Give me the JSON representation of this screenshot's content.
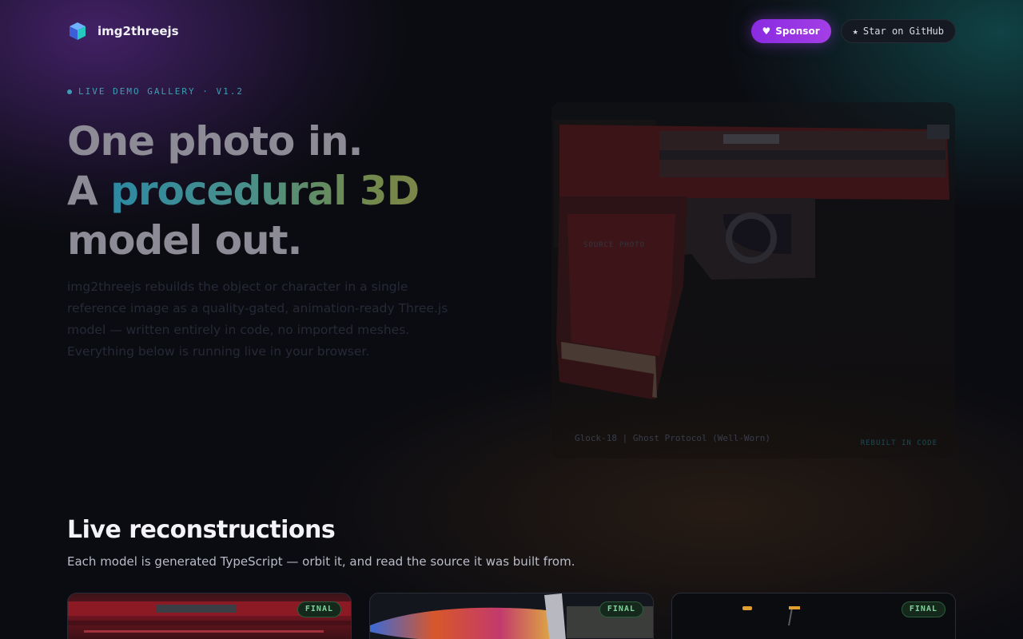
{
  "brand": {
    "name": "img2threejs",
    "logo_icon": "cube-icon"
  },
  "nav": {
    "sponsor": {
      "icon": "heart-icon",
      "label": "Sponsor"
    },
    "github": {
      "icon": "star-icon",
      "label": "Star on GitHub"
    }
  },
  "hero": {
    "eyebrow": "LIVE DEMO GALLERY · V1.2",
    "headline_line1": "One photo in.",
    "headline_line2_prefix": "A ",
    "headline_line2_highlight": "procedural 3D",
    "headline_line3": "model out.",
    "lede": "img2threejs rebuilds the object or character in a single reference image as a quality-gated, animation-ready Three.js model — written entirely in code, no imported meshes. Everything below is running live in your browser."
  },
  "viewer": {
    "reference_label": "SOURCE PHOTO",
    "caption": "Glock-18 | Ghost Protocol (Well-Worn)",
    "tag": "REBUILT IN CODE"
  },
  "gallery": {
    "title": "Live reconstructions",
    "subtitle": "Each model is generated TypeScript — orbit it, and read the source it was built from.",
    "cards": [
      {
        "badge": "FINAL",
        "accent": "#8c1a24"
      },
      {
        "badge": "FINAL",
        "accent": "#d8572a"
      },
      {
        "badge": "FINAL",
        "accent": "#e0a030"
      }
    ]
  },
  "colors": {
    "accent_purple": "#9b35e4",
    "accent_teal": "#3e9db6",
    "final_green": "#7fd39a"
  }
}
